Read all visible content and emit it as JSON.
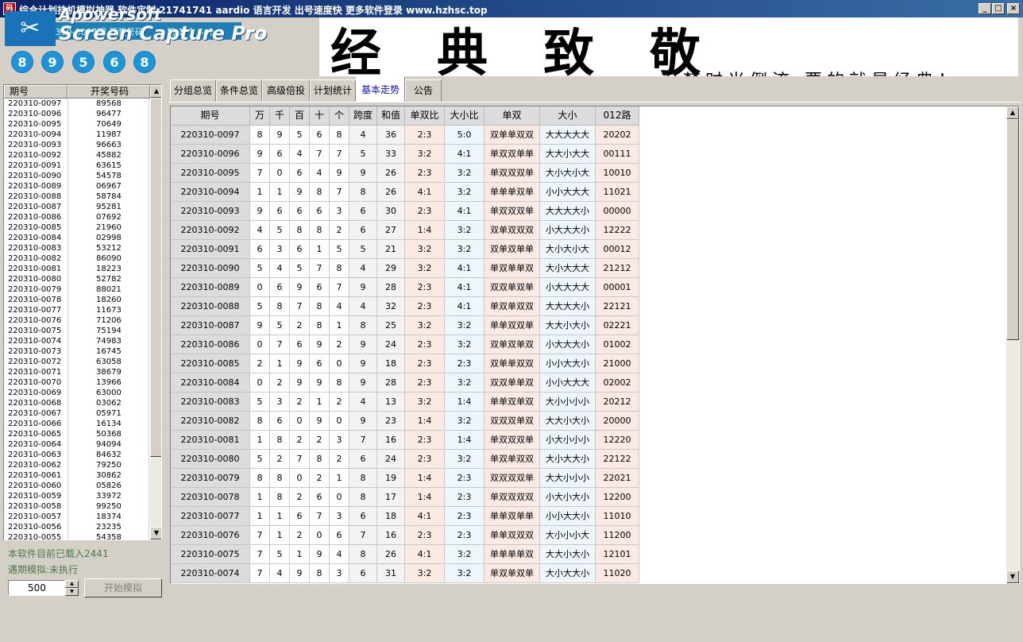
{
  "window": {
    "title": "综合计划挂机模拟神器  软件定制 21741741  aardio 语言开发  出号速度快  更多软件登录 www.hzhsc.top",
    "icon_text": "码",
    "buttons": [
      "_",
      "□",
      "×"
    ]
  },
  "watermark": {
    "line1": "Apowersoft",
    "line2": "Screen Capture Pro",
    "scissors": "✂",
    "strip_left": "第 220310-0097期   开奖号码",
    "strip_right": "第 1 个 5 个"
  },
  "latest_balls": [
    "8",
    "9",
    "5",
    "6",
    "8"
  ],
  "banner": {
    "main": "经典致敬",
    "sub": "追梦时光倒流 要的就是经典！"
  },
  "left_list": {
    "headers": [
      "期号",
      "开奖号码"
    ],
    "rows": [
      [
        "220310-0097",
        "89568"
      ],
      [
        "220310-0096",
        "96477"
      ],
      [
        "220310-0095",
        "70649"
      ],
      [
        "220310-0094",
        "11987"
      ],
      [
        "220310-0093",
        "96663"
      ],
      [
        "220310-0092",
        "45882"
      ],
      [
        "220310-0091",
        "63615"
      ],
      [
        "220310-0090",
        "54578"
      ],
      [
        "220310-0089",
        "06967"
      ],
      [
        "220310-0088",
        "58784"
      ],
      [
        "220310-0087",
        "95281"
      ],
      [
        "220310-0086",
        "07692"
      ],
      [
        "220310-0085",
        "21960"
      ],
      [
        "220310-0084",
        "02998"
      ],
      [
        "220310-0083",
        "53212"
      ],
      [
        "220310-0082",
        "86090"
      ],
      [
        "220310-0081",
        "18223"
      ],
      [
        "220310-0080",
        "52782"
      ],
      [
        "220310-0079",
        "88021"
      ],
      [
        "220310-0078",
        "18260"
      ],
      [
        "220310-0077",
        "11673"
      ],
      [
        "220310-0076",
        "71206"
      ],
      [
        "220310-0075",
        "75194"
      ],
      [
        "220310-0074",
        "74983"
      ],
      [
        "220310-0073",
        "16745"
      ],
      [
        "220310-0072",
        "63058"
      ],
      [
        "220310-0071",
        "38679"
      ],
      [
        "220310-0070",
        "13966"
      ],
      [
        "220310-0069",
        "63000"
      ],
      [
        "220310-0068",
        "03062"
      ],
      [
        "220310-0067",
        "05971"
      ],
      [
        "220310-0066",
        "16134"
      ],
      [
        "220310-0065",
        "50368"
      ],
      [
        "220310-0064",
        "94094"
      ],
      [
        "220310-0063",
        "84632"
      ],
      [
        "220310-0062",
        "79250"
      ],
      [
        "220310-0061",
        "30862"
      ],
      [
        "220310-0060",
        "05826"
      ],
      [
        "220310-0059",
        "33972"
      ],
      [
        "220310-0058",
        "99250"
      ],
      [
        "220310-0057",
        "18374"
      ],
      [
        "220310-0056",
        "23235"
      ],
      [
        "220310-0055",
        "54358"
      ]
    ],
    "scroll_up": "▲",
    "scroll_down": "▼"
  },
  "status": {
    "loaded": "本软件目前已载入2441",
    "sim": "遇期模拟:未执行"
  },
  "spin": {
    "value": "500",
    "up": "▲",
    "down": "▼"
  },
  "start_button": "开始模拟",
  "tabs": [
    "分组总览",
    "条件总览",
    "高级倍投",
    "计划统计",
    "基本走势",
    "公告"
  ],
  "active_tab": "基本走势",
  "grid": {
    "headers": [
      "期号",
      "万",
      "千",
      "百",
      "十",
      "个",
      "跨度",
      "和值",
      "单双比",
      "大小比",
      "单双",
      "大小",
      "012路"
    ],
    "rows": [
      [
        "220310-0097",
        "8",
        "9",
        "5",
        "6",
        "8",
        "4",
        "36",
        "2:3",
        "5:0",
        "双单单双双",
        "大大大大大",
        "20202"
      ],
      [
        "220310-0096",
        "9",
        "6",
        "4",
        "7",
        "7",
        "5",
        "33",
        "3:2",
        "4:1",
        "单双双单单",
        "大大小大大",
        "00111"
      ],
      [
        "220310-0095",
        "7",
        "0",
        "6",
        "4",
        "9",
        "9",
        "26",
        "2:3",
        "3:2",
        "单双双双单",
        "大小大小大",
        "10010"
      ],
      [
        "220310-0094",
        "1",
        "1",
        "9",
        "8",
        "7",
        "8",
        "26",
        "4:1",
        "3:2",
        "单单单双单",
        "小小大大大",
        "11021"
      ],
      [
        "220310-0093",
        "9",
        "6",
        "6",
        "6",
        "3",
        "6",
        "30",
        "2:3",
        "4:1",
        "单双双双单",
        "大大大大小",
        "00000"
      ],
      [
        "220310-0092",
        "4",
        "5",
        "8",
        "8",
        "2",
        "6",
        "27",
        "1:4",
        "3:2",
        "双单双双双",
        "小大大大小",
        "12222"
      ],
      [
        "220310-0091",
        "6",
        "3",
        "6",
        "1",
        "5",
        "5",
        "21",
        "3:2",
        "3:2",
        "双单双单单",
        "大小大小大",
        "00012"
      ],
      [
        "220310-0090",
        "5",
        "4",
        "5",
        "7",
        "8",
        "4",
        "29",
        "3:2",
        "4:1",
        "单双单单双",
        "大小大大大",
        "21212"
      ],
      [
        "220310-0089",
        "0",
        "6",
        "9",
        "6",
        "7",
        "9",
        "28",
        "2:3",
        "4:1",
        "双双单双单",
        "小大大大大",
        "00001"
      ],
      [
        "220310-0088",
        "5",
        "8",
        "7",
        "8",
        "4",
        "4",
        "32",
        "2:3",
        "4:1",
        "单双单双双",
        "大大大大小",
        "22121"
      ],
      [
        "220310-0087",
        "9",
        "5",
        "2",
        "8",
        "1",
        "8",
        "25",
        "3:2",
        "3:2",
        "单单双双单",
        "大大小大小",
        "02221"
      ],
      [
        "220310-0086",
        "0",
        "7",
        "6",
        "9",
        "2",
        "9",
        "24",
        "2:3",
        "3:2",
        "双单双单双",
        "小大大大小",
        "01002"
      ],
      [
        "220310-0085",
        "2",
        "1",
        "9",
        "6",
        "0",
        "9",
        "18",
        "2:3",
        "2:3",
        "双单单双双",
        "小小大大小",
        "21000"
      ],
      [
        "220310-0084",
        "0",
        "2",
        "9",
        "9",
        "8",
        "9",
        "28",
        "2:3",
        "3:2",
        "双双单单双",
        "小小大大大",
        "02002"
      ],
      [
        "220310-0083",
        "5",
        "3",
        "2",
        "1",
        "2",
        "4",
        "13",
        "3:2",
        "1:4",
        "单单双单双",
        "大小小小小",
        "20212"
      ],
      [
        "220310-0082",
        "8",
        "6",
        "0",
        "9",
        "0",
        "9",
        "23",
        "1:4",
        "3:2",
        "双双双单双",
        "大大小大小",
        "20000"
      ],
      [
        "220310-0081",
        "1",
        "8",
        "2",
        "2",
        "3",
        "7",
        "16",
        "2:3",
        "1:4",
        "单双双双单",
        "小大小小小",
        "12220"
      ],
      [
        "220310-0080",
        "5",
        "2",
        "7",
        "8",
        "2",
        "6",
        "24",
        "2:3",
        "3:2",
        "单双单双双",
        "大小大大小",
        "22122"
      ],
      [
        "220310-0079",
        "8",
        "8",
        "0",
        "2",
        "1",
        "8",
        "19",
        "1:4",
        "2:3",
        "双双双双单",
        "大大小小小",
        "22021"
      ],
      [
        "220310-0078",
        "1",
        "8",
        "2",
        "6",
        "0",
        "8",
        "17",
        "1:4",
        "2:3",
        "单双双双双",
        "小大小大小",
        "12200"
      ],
      [
        "220310-0077",
        "1",
        "1",
        "6",
        "7",
        "3",
        "6",
        "18",
        "4:1",
        "2:3",
        "单单双单单",
        "小小大大小",
        "11010"
      ],
      [
        "220310-0076",
        "7",
        "1",
        "2",
        "0",
        "6",
        "7",
        "16",
        "2:3",
        "2:3",
        "单单双双双",
        "大小小小大",
        "11200"
      ],
      [
        "220310-0075",
        "7",
        "5",
        "1",
        "9",
        "4",
        "8",
        "26",
        "4:1",
        "3:2",
        "单单单单双",
        "大大小大小",
        "12101"
      ],
      [
        "220310-0074",
        "7",
        "4",
        "9",
        "8",
        "3",
        "6",
        "31",
        "3:2",
        "3:2",
        "单双单双单",
        "大小大大小",
        "11020"
      ]
    ]
  }
}
